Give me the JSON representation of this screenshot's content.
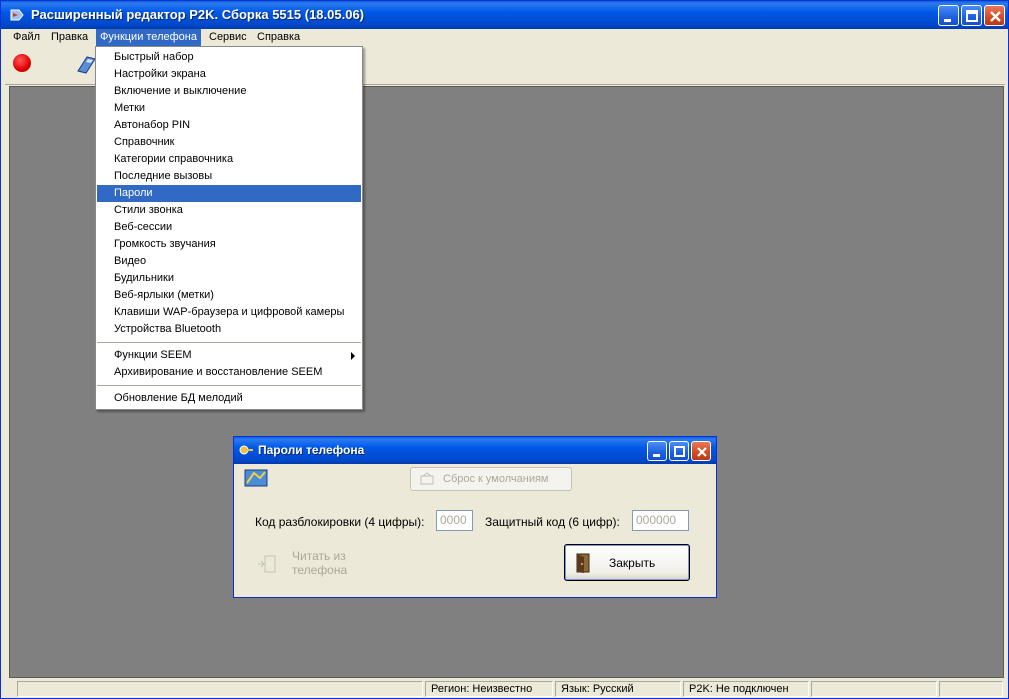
{
  "window": {
    "title": "Расширенный редактор P2K. Сборка 5515 (18.05.06)"
  },
  "menubar": {
    "items": [
      "Файл",
      "Правка",
      "Функции телефона",
      "Сервис",
      "Справка"
    ]
  },
  "dropdown": {
    "items": [
      "Быстрый набор",
      "Настройки экрана",
      "Включение и выключение",
      "Метки",
      "Автонабор PIN",
      "Справочник",
      "Категории справочника",
      "Последние вызовы",
      "Пароли",
      "Стили звонка",
      "Веб-сессии",
      "Громкость звучания",
      "Видео",
      "Будильники",
      "Веб-ярлыки (метки)",
      "Клавиши WAP-браузера и цифровой камеры",
      "Устройства Bluetooth"
    ],
    "highlighted": "Пароли",
    "seem_items": [
      "Функции SEEM",
      "Архивирование и восстановление SEEM"
    ],
    "last_item": "Обновление БД мелодий"
  },
  "dialog": {
    "title": "Пароли телефона",
    "reset_label": "Сброс к умолчаниям",
    "unlock_label": "Код разблокировки (4 цифры):",
    "unlock_value": "0000",
    "security_label": "Защитный код (6 цифр):",
    "security_value": "000000",
    "read_line1": "Читать из",
    "read_line2": "телефона",
    "close_label": "Закрыть"
  },
  "statusbar": {
    "region": "Регион: Неизвестно",
    "language": "Язык: Русский",
    "connection": "P2K: Не подключен"
  },
  "colors": {
    "title_blue": "#0058e6",
    "highlight": "#316ac5",
    "client_gray": "#808080",
    "face": "#ece9d8",
    "record_red": "#e00000"
  }
}
